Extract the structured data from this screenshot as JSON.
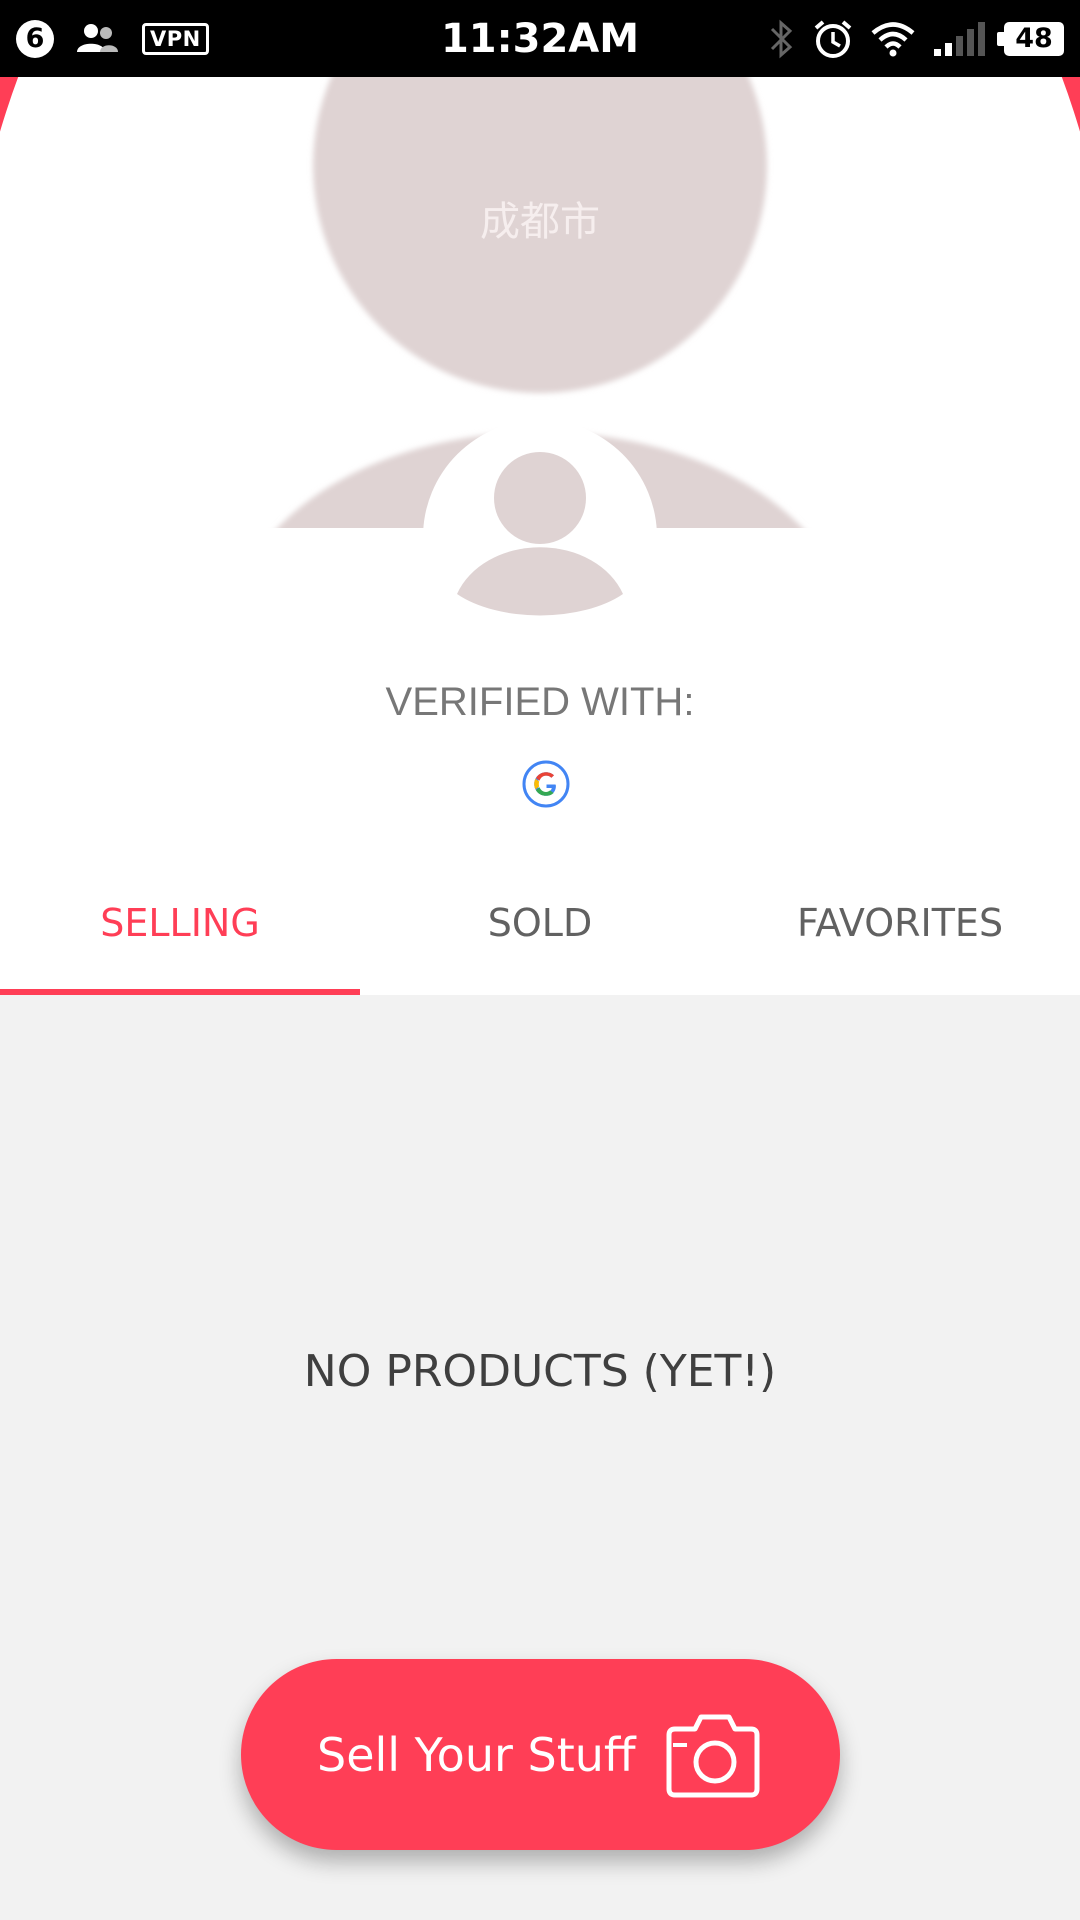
{
  "status_bar": {
    "notification_count": "6",
    "vpn_label": "VPN",
    "time": "11:32AM",
    "battery": "48"
  },
  "profile": {
    "cover_location": "成都市",
    "verified_label": "VERIFIED WITH:",
    "verified_provider_icon": "google-icon"
  },
  "tabs": [
    {
      "label": "SELLING",
      "active": true
    },
    {
      "label": "SOLD",
      "active": false
    },
    {
      "label": "FAVORITES",
      "active": false
    }
  ],
  "empty_state": {
    "message": "NO PRODUCTS (YET!)"
  },
  "fab": {
    "label": "Sell Your Stuff",
    "icon": "camera-icon"
  },
  "colors": {
    "accent": "#ff3e56",
    "placeholder": "#dfd3d3",
    "background": "#f2f2f2"
  }
}
